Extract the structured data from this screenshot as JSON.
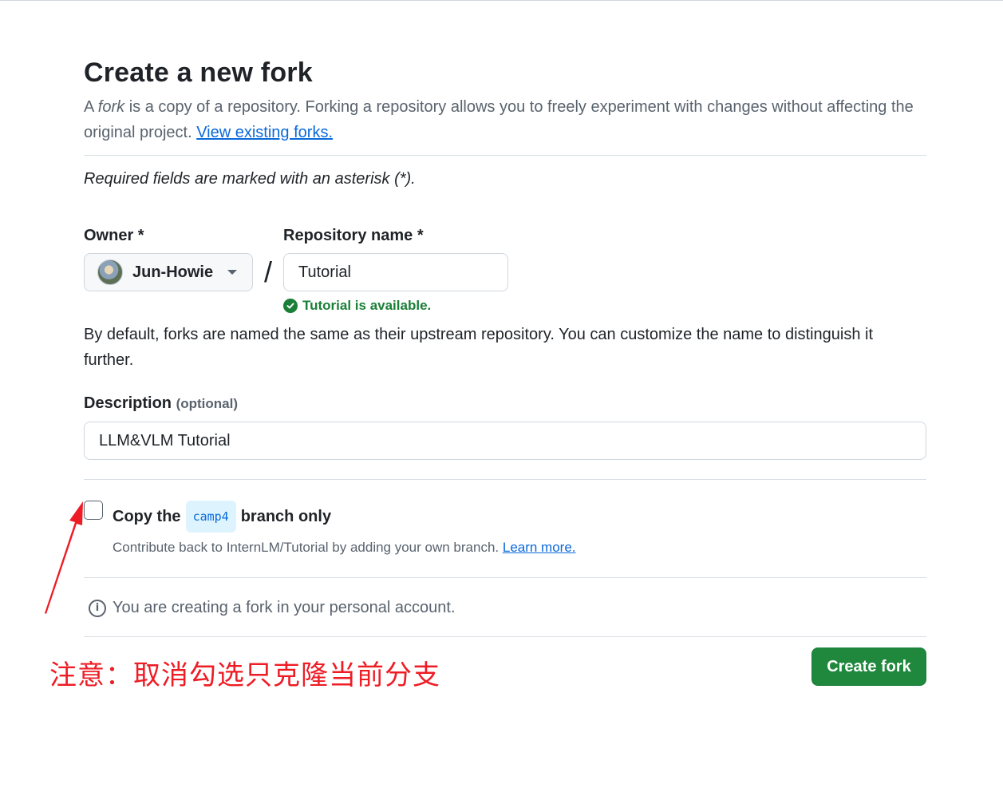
{
  "page": {
    "title": "Create a new fork",
    "subtitle_prefix": "A ",
    "subtitle_fork_word": "fork",
    "subtitle_rest": " is a copy of a repository. Forking a repository allows you to freely experiment with changes without affecting the original project. ",
    "view_forks_link": "View existing forks.",
    "required_note": "Required fields are marked with an asterisk (*)."
  },
  "owner": {
    "label": "Owner *",
    "value": "Jun-Howie"
  },
  "slash": "/",
  "repo": {
    "label": "Repository name *",
    "value": "Tutorial",
    "availability": "Tutorial is available."
  },
  "default_note": "By default, forks are named the same as their upstream repository. You can customize the name to distinguish it further.",
  "description": {
    "label": "Description",
    "optional": "(optional)",
    "value": "LLM&VLM Tutorial"
  },
  "copy_branch": {
    "prefix": "Copy the",
    "branch": "camp4",
    "suffix": "branch only",
    "checked": false,
    "sub_text": "Contribute back to InternLM/Tutorial by adding your own branch. ",
    "learn_more": "Learn more."
  },
  "personal_note": "You are creating a fork in your personal account.",
  "create_button": "Create fork",
  "annotation": "注意：取消勾选只克隆当前分支",
  "colors": {
    "primary_button": "#1f883d",
    "success": "#1a7f37",
    "link": "#0969da",
    "annotation": "#ee1c25"
  }
}
